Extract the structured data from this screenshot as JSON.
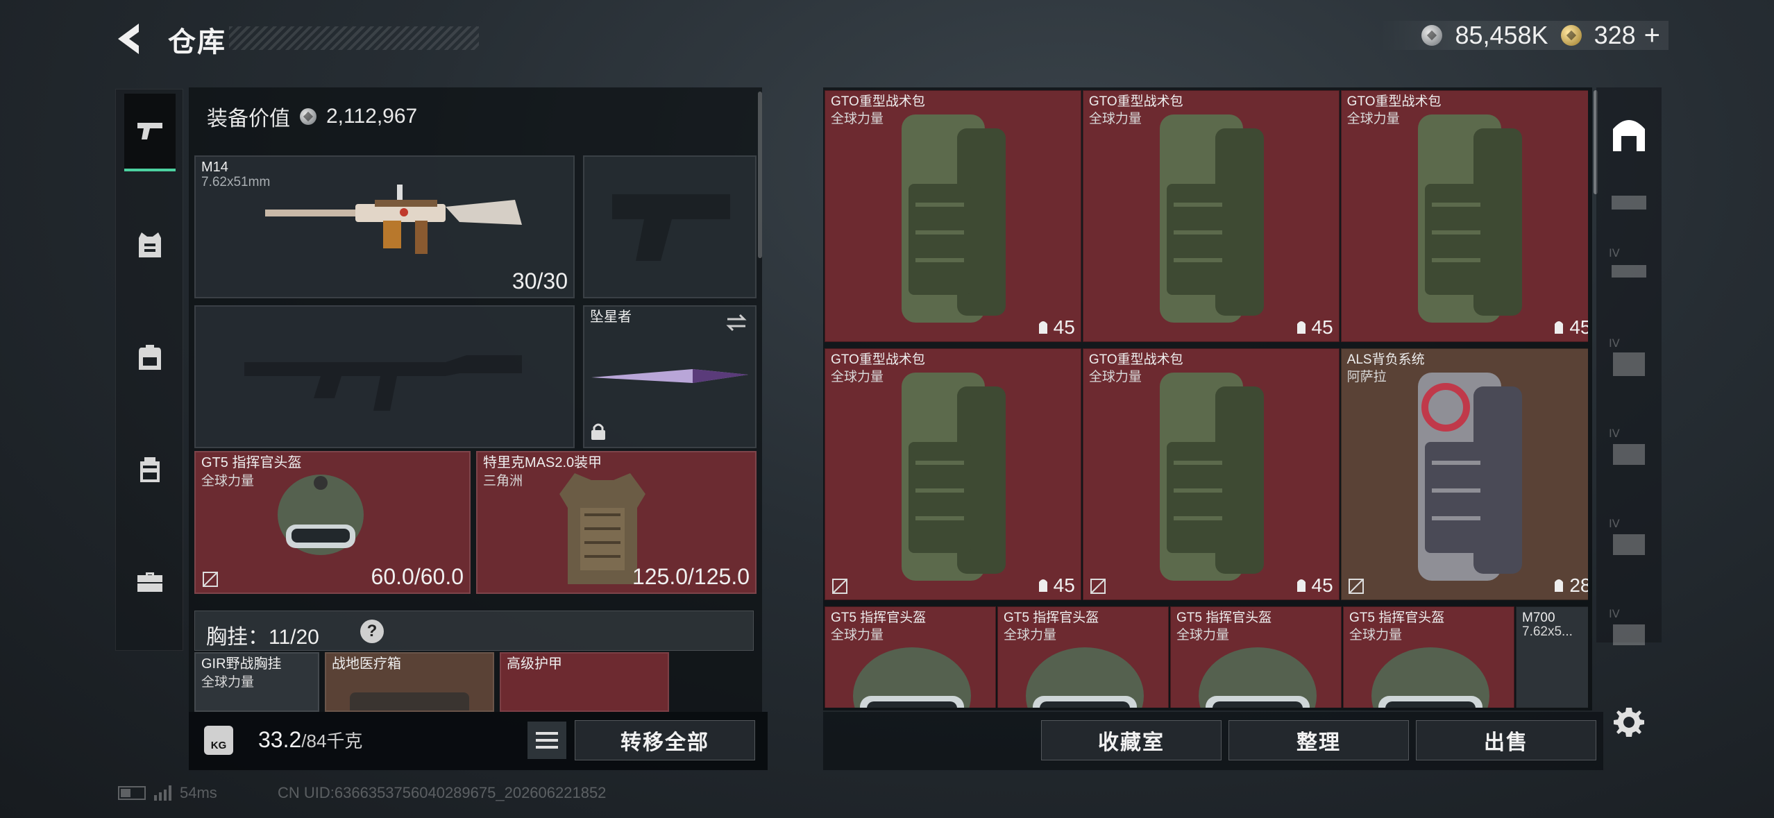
{
  "header": {
    "title": "仓库",
    "silver_currency": "85,458K",
    "gold_currency": "328",
    "add_symbol": "+"
  },
  "left_nav": {
    "items": [
      {
        "name": "weapons",
        "icon": "pistol-icon",
        "active": true
      },
      {
        "name": "armor",
        "icon": "vest-icon",
        "active": false
      },
      {
        "name": "backpack",
        "icon": "backpack-icon",
        "active": false
      },
      {
        "name": "chest-rig",
        "icon": "chest-rig-icon",
        "active": false
      },
      {
        "name": "supplies",
        "icon": "briefcase-icon",
        "active": false
      }
    ]
  },
  "loadout": {
    "value_label": "装备价值",
    "value": "2,112,967",
    "primary": {
      "name": "M14",
      "caliber": "7.62x51mm",
      "ammo": "30/30"
    },
    "melee": {
      "name": "坠星者"
    },
    "helmet": {
      "name": "GT5 指挥官头盔",
      "faction": "全球力量",
      "durability": "60.0/60.0"
    },
    "armor": {
      "name": "特里克MAS2.0装甲",
      "faction": "三角洲",
      "durability": "125.0/125.0"
    },
    "chest_label": "胸挂：11/20",
    "help_symbol": "?",
    "chest_items": [
      {
        "name": "GIR野战胸挂",
        "faction": "全球力量"
      },
      {
        "name": "战地医疗箱"
      },
      {
        "name": "高级护甲"
      }
    ],
    "weight_value": "33.2",
    "weight_max": "/84千克",
    "kg_label": "KG",
    "transfer_all": "转移全部"
  },
  "storage": {
    "items": [
      {
        "name": "GTO重型战术包",
        "faction": "全球力量",
        "capacity": "45",
        "nosell": false,
        "kind": "pack"
      },
      {
        "name": "GTO重型战术包",
        "faction": "全球力量",
        "capacity": "45",
        "nosell": false,
        "kind": "pack"
      },
      {
        "name": "GTO重型战术包",
        "faction": "全球力量",
        "capacity": "45",
        "nosell": false,
        "kind": "pack"
      },
      {
        "name": "GTO重型战术包",
        "faction": "全球力量",
        "capacity": "45",
        "nosell": true,
        "kind": "pack"
      },
      {
        "name": "GTO重型战术包",
        "faction": "全球力量",
        "capacity": "45",
        "nosell": true,
        "kind": "pack"
      },
      {
        "name": "ALS背负系统",
        "faction": "阿萨拉",
        "capacity": "28",
        "nosell": true,
        "kind": "als"
      },
      {
        "name": "GT5 指挥官头盔",
        "faction": "全球力量",
        "kind": "helmet"
      },
      {
        "name": "GT5 指挥官头盔",
        "faction": "全球力量",
        "kind": "helmet"
      },
      {
        "name": "GT5 指挥官头盔",
        "faction": "全球力量",
        "kind": "helmet"
      },
      {
        "name": "GT5 指挥官头盔",
        "faction": "全球力量",
        "kind": "helmet"
      },
      {
        "name": "M700",
        "faction": "7.62x5...",
        "kind": "rifle"
      }
    ],
    "buttons": {
      "collection": "收藏室",
      "sort": "整理",
      "sell": "出售"
    }
  },
  "status_bar": {
    "ping": "54ms",
    "uid": "CN UID:6366353756040289675_202606221852"
  },
  "colors": {
    "accent_green": "#4cd1a0",
    "red_rarity": "#6d2a30",
    "gold_rarity": "#5a4236"
  }
}
